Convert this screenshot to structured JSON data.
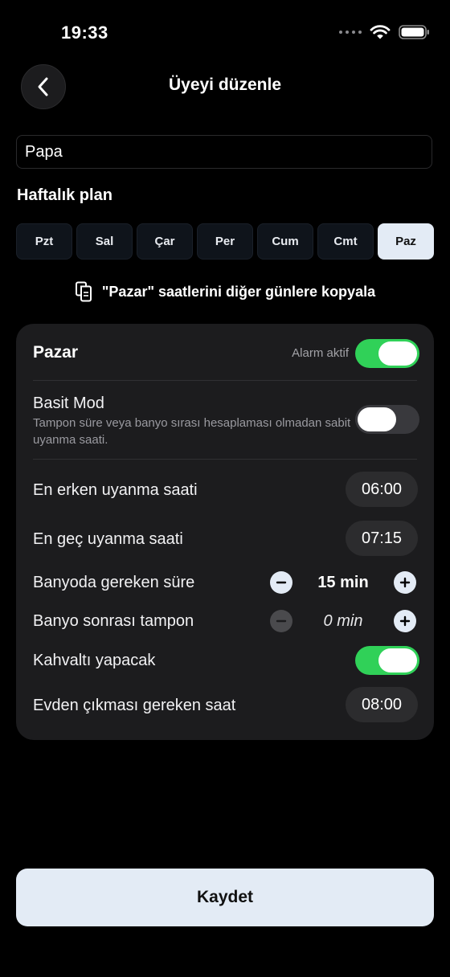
{
  "status_bar": {
    "time": "19:33"
  },
  "header": {
    "title": "Üyeyi düzenle"
  },
  "name_field": {
    "value": "Papa"
  },
  "weekly_plan": {
    "title": "Haftalık plan",
    "days": [
      "Pzt",
      "Sal",
      "Çar",
      "Per",
      "Cum",
      "Cmt",
      "Paz"
    ],
    "selected_index": 6
  },
  "copy_action": {
    "label": "\"Pazar\" saatlerini diğer günlere kopyala"
  },
  "day_card": {
    "title": "Pazar",
    "alarm_label": "Alarm aktif",
    "alarm_on": true,
    "simple_mode": {
      "label": "Basit Mod",
      "description": "Tampon süre veya banyo sırası hesaplaması olmadan sabit uyanma saati.",
      "on": false
    },
    "earliest_wake": {
      "label": "En erken uyanma saati",
      "value": "06:00"
    },
    "latest_wake": {
      "label": "En geç uyanma saati",
      "value": "07:15"
    },
    "bathroom_time": {
      "label": "Banyoda gereken süre",
      "value": "15 min"
    },
    "bathroom_buffer": {
      "label": "Banyo sonrası tampon",
      "value": "0 min"
    },
    "breakfast": {
      "label": "Kahvaltı yapacak",
      "on": true
    },
    "leave_time": {
      "label": "Evden çıkması gereken saat",
      "value": "08:00"
    }
  },
  "save_button": {
    "label": "Kaydet"
  },
  "colors": {
    "accent_green": "#30d158",
    "light_button": "#e3ebf5",
    "card": "#1c1c1e"
  }
}
